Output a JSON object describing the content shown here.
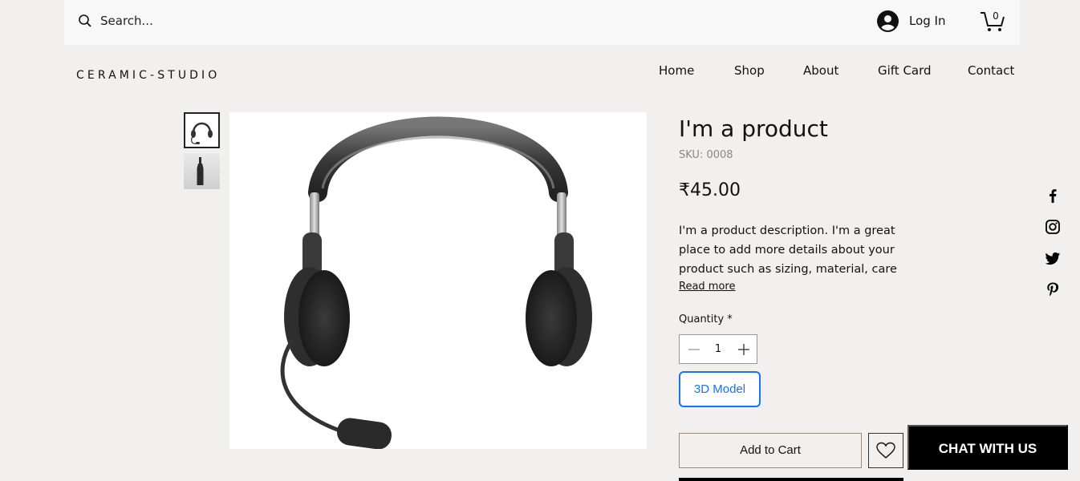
{
  "search": {
    "placeholder": "Search..."
  },
  "account": {
    "login_label": "Log In"
  },
  "cart": {
    "count": "0"
  },
  "brand": {
    "name": "CERAMIC-STUDIO"
  },
  "nav": [
    {
      "label": "Home"
    },
    {
      "label": "Shop"
    },
    {
      "label": "About"
    },
    {
      "label": "Gift Card"
    },
    {
      "label": "Contact"
    }
  ],
  "product": {
    "title": "I'm a product",
    "sku": "SKU: 0008",
    "price": "₹45.00",
    "description": "I'm a product description. I'm a great place to add more details about your product such as sizing, material, care",
    "read_more": "Read more",
    "quantity_label": "Quantity *",
    "quantity_value": "1",
    "model_button": "3D Model",
    "add_to_cart": "Add to Cart"
  },
  "gallery": {
    "thumbnails": [
      "headset-thumbnail",
      "bottle-thumbnail"
    ],
    "active_index": 0
  },
  "social": [
    "facebook-icon",
    "instagram-icon",
    "twitter-icon",
    "pinterest-icon"
  ],
  "chat": {
    "label": "CHAT WITH US"
  },
  "colors": {
    "accent": "#1a73e8",
    "background": "#f2f0ee",
    "cart_border": "#a08a75"
  }
}
